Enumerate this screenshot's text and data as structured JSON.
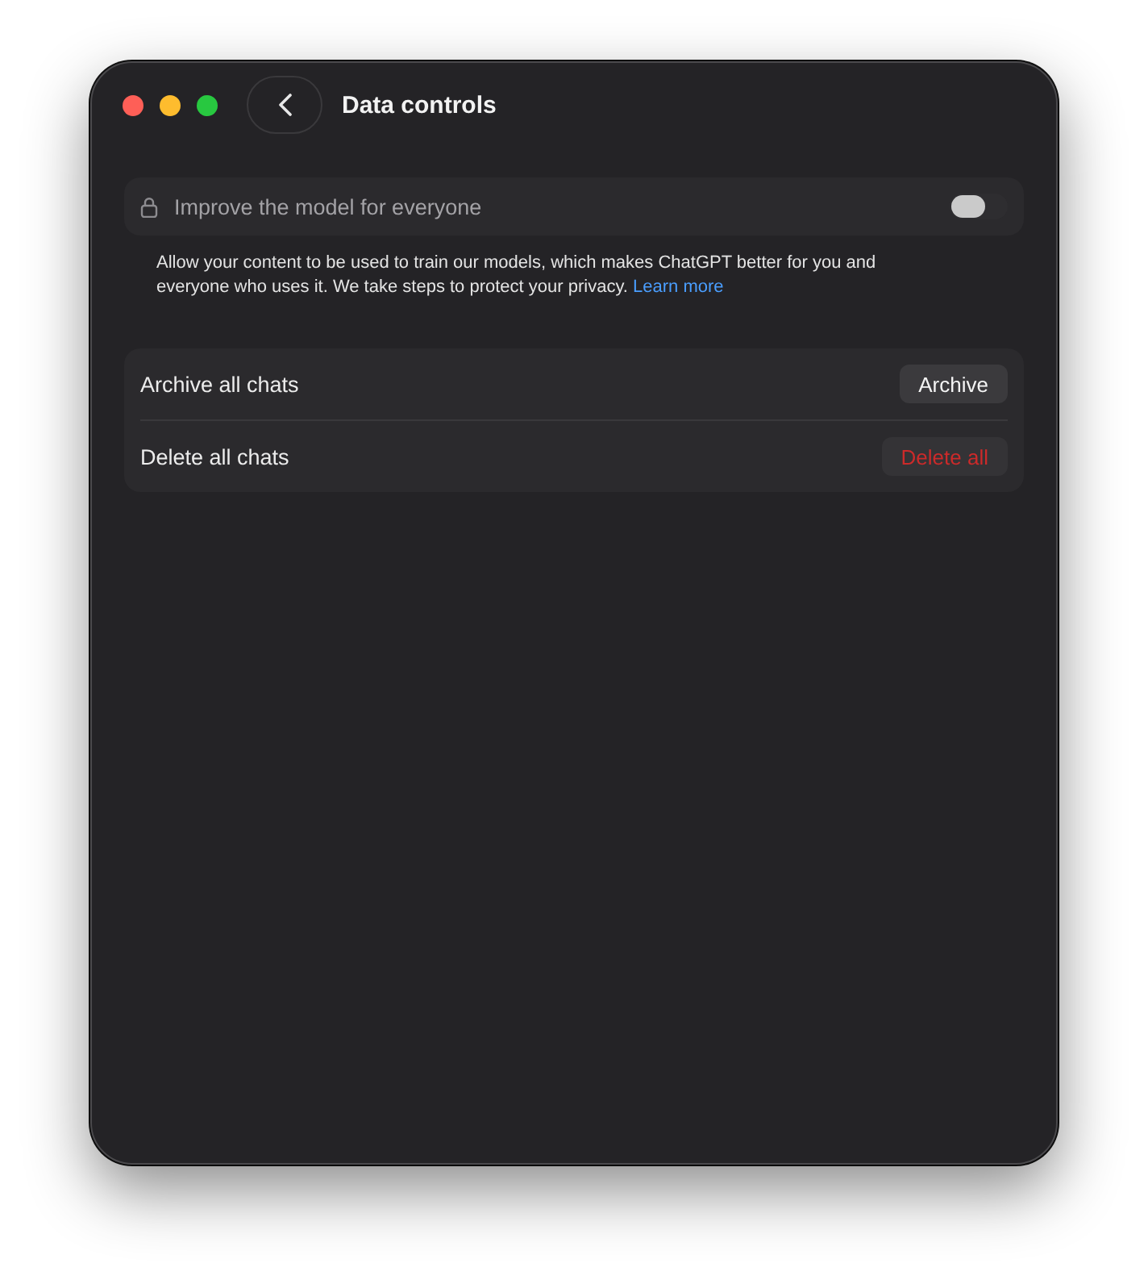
{
  "window": {
    "title": "Data controls"
  },
  "training_setting": {
    "label": "Improve the model for everyone",
    "disabled": true,
    "on": false
  },
  "description": {
    "text": "Allow your content to be used to train our models, which makes ChatGPT better for you and everyone who uses it. We take steps to protect your privacy.",
    "link": "Learn more"
  },
  "actions": [
    {
      "label": "Archive all chats",
      "button": "Archive",
      "kind": "default"
    },
    {
      "label": "Delete all chats",
      "button": "Delete all",
      "kind": "danger"
    }
  ]
}
